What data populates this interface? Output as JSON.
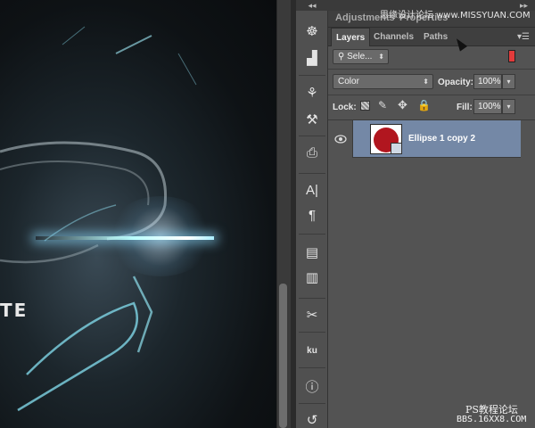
{
  "canvas": {
    "visible_text": "TE"
  },
  "toolstrip": {
    "collapse_glyph": "◂◂",
    "tools": [
      {
        "name": "navigator-icon",
        "glyph": "☸"
      },
      {
        "name": "histogram-icon",
        "glyph": "▟"
      },
      {
        "name": "brush-presets-icon",
        "glyph": "⚘"
      },
      {
        "name": "tool-presets-icon",
        "glyph": "⚒"
      },
      {
        "name": "clone-source-icon",
        "glyph": "⎙"
      },
      {
        "name": "character-icon",
        "glyph": "A|"
      },
      {
        "name": "paragraph-icon",
        "glyph": "¶"
      },
      {
        "name": "character-styles-icon",
        "glyph": "▤"
      },
      {
        "name": "paragraph-styles-icon",
        "glyph": "▥"
      },
      {
        "name": "tools-icon",
        "glyph": "✂"
      },
      {
        "name": "kuler-icon",
        "glyph": "ku"
      },
      {
        "name": "info-icon",
        "glyph": "ⓘ"
      },
      {
        "name": "history-icon",
        "glyph": "↺"
      }
    ]
  },
  "panels": {
    "top_collapse": "▸▸",
    "upper_tabs": [
      "Adjustments",
      "Properties"
    ],
    "tabs": [
      "Layers",
      "Channels",
      "Paths"
    ],
    "active_tab": "Layers",
    "filter": {
      "icon": "⚲",
      "value": "Sele..."
    },
    "blend_mode": "Color",
    "opacity": {
      "label": "Opacity:",
      "value": "100%"
    },
    "lock": {
      "label": "Lock:"
    },
    "fill": {
      "label": "Fill:",
      "value": "100%"
    },
    "layers": [
      {
        "name": "Ellipse 1 copy 2",
        "visible": true,
        "thumb_color": "#b1161f",
        "selected": true
      }
    ]
  },
  "watermarks": {
    "top": "思缘设计论坛 www.MISSYUAN.COM",
    "bottom_line1": "PS教程论坛",
    "bottom_line2": "BBS.16XX8.COM"
  }
}
